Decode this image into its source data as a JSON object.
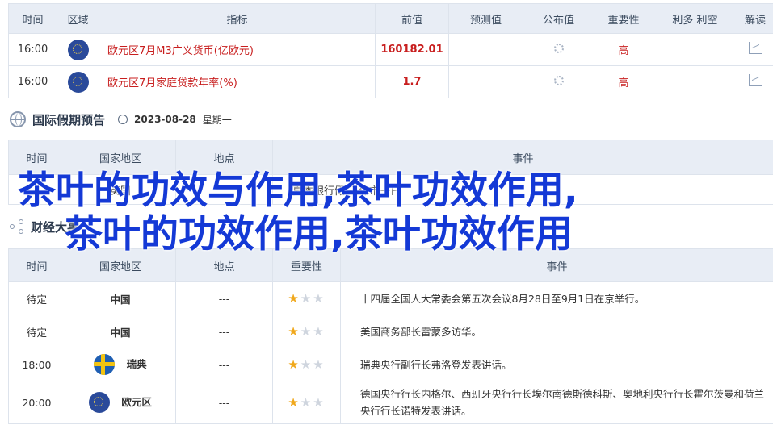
{
  "econ_table": {
    "headers": [
      "时间",
      "区域",
      "指标",
      "前值",
      "预测值",
      "公布值",
      "重要性",
      "利多 利空",
      "解读"
    ],
    "rows": [
      {
        "time": "16:00",
        "region_flag": "eu-flag",
        "indicator": "欧元区7月M3广义货币(亿欧元)",
        "prev": "160182.01",
        "importance": "高"
      },
      {
        "time": "16:00",
        "region_flag": "eu-flag",
        "indicator": "欧元区7月家庭贷款年率(%)",
        "prev": "1.7",
        "importance": "高"
      }
    ]
  },
  "holiday": {
    "title": "国际假期预告",
    "date": "2023-08-28",
    "weekday": "星期一",
    "headers": [
      "时间",
      "国家地区",
      "地点",
      "事件"
    ],
    "rows": [
      {
        "time": "",
        "country": "英国",
        "place": "",
        "event": "夏季银行假日,休市一日"
      }
    ]
  },
  "events": {
    "title": "财经大事",
    "headers": [
      "时间",
      "国家地区",
      "地点",
      "重要性",
      "事件"
    ],
    "rows": [
      {
        "time": "待定",
        "country": "中国",
        "place": "---",
        "stars": 1,
        "event": "十四届全国人大常委会第五次会议8月28日至9月1日在京举行。"
      },
      {
        "time": "待定",
        "country": "中国",
        "place": "---",
        "stars": 1,
        "event": "美国商务部长雷蒙多访华。"
      },
      {
        "time": "18:00",
        "country": "瑞典",
        "place": "---",
        "stars": 1,
        "event": "瑞典央行副行长弗洛登发表讲话。"
      },
      {
        "time": "20:00",
        "country": "欧元区",
        "place": "---",
        "stars": 1,
        "event": "德国央行行长内格尔、西班牙央行行长埃尔南德斯德科斯、奥地利央行行长霍尔茨曼和荷兰央行行长诺特发表讲话。"
      }
    ]
  },
  "overlay": {
    "line1": "茶叶的功效与作用,茶叶功效作用,",
    "line2": "茶叶的功效作用,茶叶功效作用"
  },
  "colors": {
    "accent_red": "#c81e1e",
    "overlay_blue": "#1439d6",
    "header_bg": "#e8edf5"
  }
}
